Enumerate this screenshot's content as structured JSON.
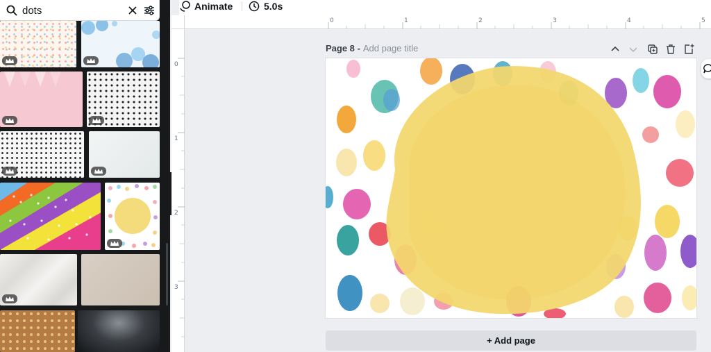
{
  "search": {
    "value": "dots"
  },
  "toolbar": {
    "animate_label": "Animate",
    "duration_label": "5.0s"
  },
  "ruler": {
    "top_ticks": [
      "0",
      "1",
      "2",
      "3",
      "4",
      "5"
    ],
    "left_ticks": [
      "0",
      "1",
      "2",
      "3"
    ]
  },
  "page": {
    "label": "Page 8 -",
    "title_placeholder": "Add page title",
    "add_page_label": "+ Add page"
  },
  "thumbnails": [
    "confetti-dots",
    "blue-bokeh-dots",
    "pink-bunting",
    "white-black-polka-dots",
    "white-black-polka-dots-2",
    "white-gray-texture",
    "rainbow-stripes-dots",
    "watercolor-dots-yellow-circle",
    "crumpled-paper",
    "beige-paper",
    "gold-dots-kraft",
    "dark-metal-mesh"
  ],
  "colors": {
    "accent": "#7d2ae8",
    "panel_bg": "#18191b",
    "canvas_bg": "#eceef2",
    "sun": "#f3d76d"
  }
}
